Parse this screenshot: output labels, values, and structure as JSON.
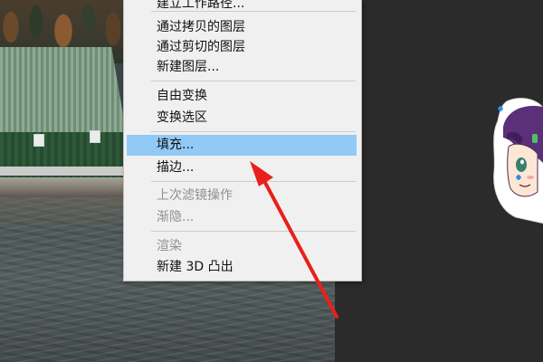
{
  "context_menu": {
    "items": [
      {
        "label": "建立工作路径...",
        "enabled": true
      },
      {
        "label": "通过拷贝的图层",
        "enabled": true
      },
      {
        "label": "通过剪切的图层",
        "enabled": true
      },
      {
        "label": "新建图层...",
        "enabled": true
      },
      {
        "label": "自由变换",
        "enabled": true
      },
      {
        "label": "变换选区",
        "enabled": true
      },
      {
        "label": "填充...",
        "enabled": true,
        "highlighted": true
      },
      {
        "label": "描边...",
        "enabled": true
      },
      {
        "label": "上次滤镜操作",
        "enabled": false
      },
      {
        "label": "渐隐...",
        "enabled": false
      },
      {
        "label": "渲染",
        "enabled": false
      },
      {
        "label": "新建 3D 凸出",
        "enabled": true
      }
    ]
  },
  "colors": {
    "menu_background": "#f0f0f0",
    "highlight": "#91c9f7",
    "annotation_arrow": "#e8201a",
    "canvas_background": "#2b2b2b"
  },
  "icons": {
    "annotation": "red-arrow-icon",
    "sticker": "anime-character-sticker-icon"
  }
}
